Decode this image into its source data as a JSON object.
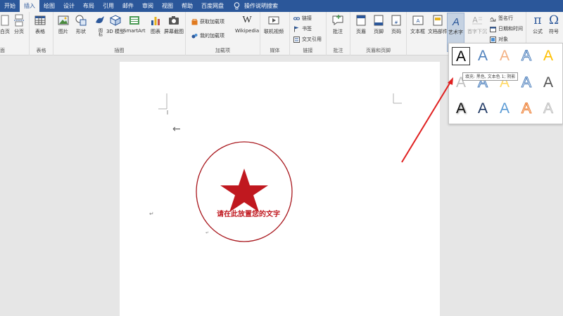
{
  "tabs": [
    "开始",
    "插入",
    "绘图",
    "设计",
    "布局",
    "引用",
    "邮件",
    "审阅",
    "视图",
    "帮助",
    "百度网盘"
  ],
  "active_tab": "插入",
  "tell_me": "操作说明搜索",
  "ribbon": {
    "page_btn1": "白页",
    "page_btn2": "分页",
    "page_group": "面",
    "table_btn": "表格",
    "table_group": "表格",
    "picture": "图片",
    "shapes": "形状",
    "icons": "图标",
    "model3d": "3D 模型",
    "smartart": "SmartArt",
    "chart": "图表",
    "screenshot": "屏幕截图",
    "illus_group": "插图",
    "get_addins": "获取加载项",
    "my_addins": "我的加载项",
    "wikipedia": "Wikipedia",
    "addins_group": "加载项",
    "online_video": "联机视频",
    "media_group": "媒体",
    "link": "链接",
    "bookmark": "书签",
    "crossref": "交叉引用",
    "links_group": "链接",
    "comment": "批注",
    "comment_group": "批注",
    "header": "页眉",
    "footer": "页脚",
    "page_number": "页码",
    "hf_group": "页眉和页脚",
    "textbox": "文本框",
    "docparts": "文档部件",
    "wordart": "艺术字",
    "dropcap": "首字下沉",
    "signature": "签名行",
    "datetime": "日期和时间",
    "object": "对象",
    "equation": "公式",
    "symbol": "符号"
  },
  "document": {
    "stamp_text": "请在此放置您的文字"
  },
  "wordart_gallery": {
    "glyph": "A",
    "tooltip": "填充: 黑色, 文本色 1; 阴影"
  },
  "colors": {
    "brand": "#2b579a",
    "stamp_red": "#c0181f",
    "arrow_red": "#e02020"
  }
}
